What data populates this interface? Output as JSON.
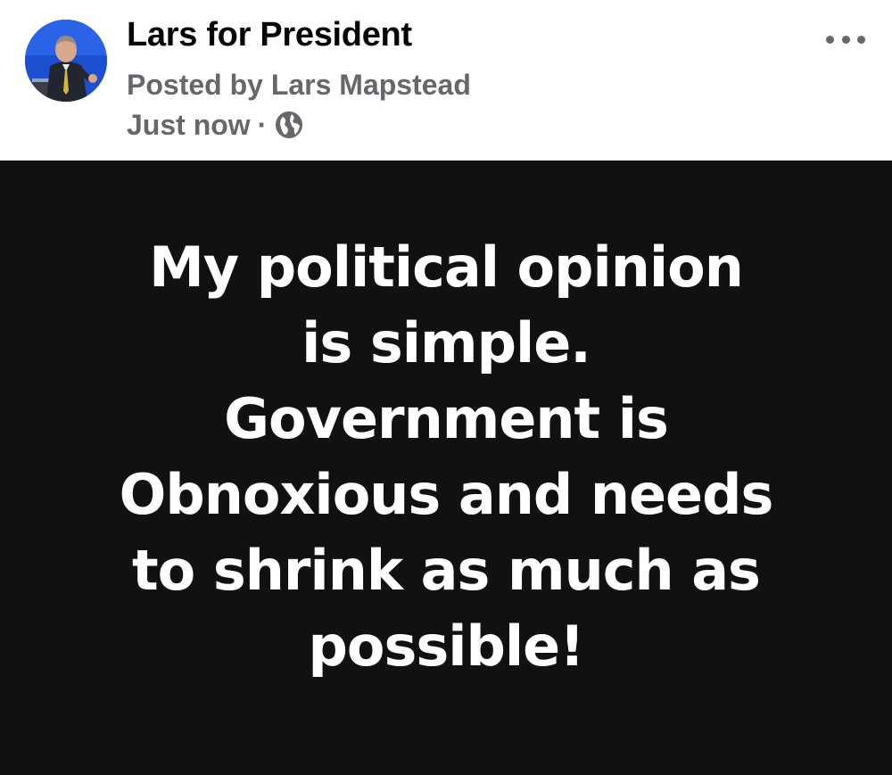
{
  "post": {
    "page_name": "Lars for President",
    "posted_by": "Posted by Lars Mapstead",
    "timestamp": "Just now",
    "separator": "·",
    "privacy_icon": "globe-icon",
    "more_icon": "more-options-icon",
    "text_lines": [
      "My political opinion",
      "is simple.",
      "Government is",
      "Obnoxious and needs",
      "to shrink as much as",
      "possible!"
    ]
  },
  "colors": {
    "header_bg": "#ffffff",
    "body_bg": "#111111",
    "title_text": "#050505",
    "secondary_text": "#65676b",
    "post_text": "#ffffff",
    "avatar_bg": "#1d4fd1"
  }
}
